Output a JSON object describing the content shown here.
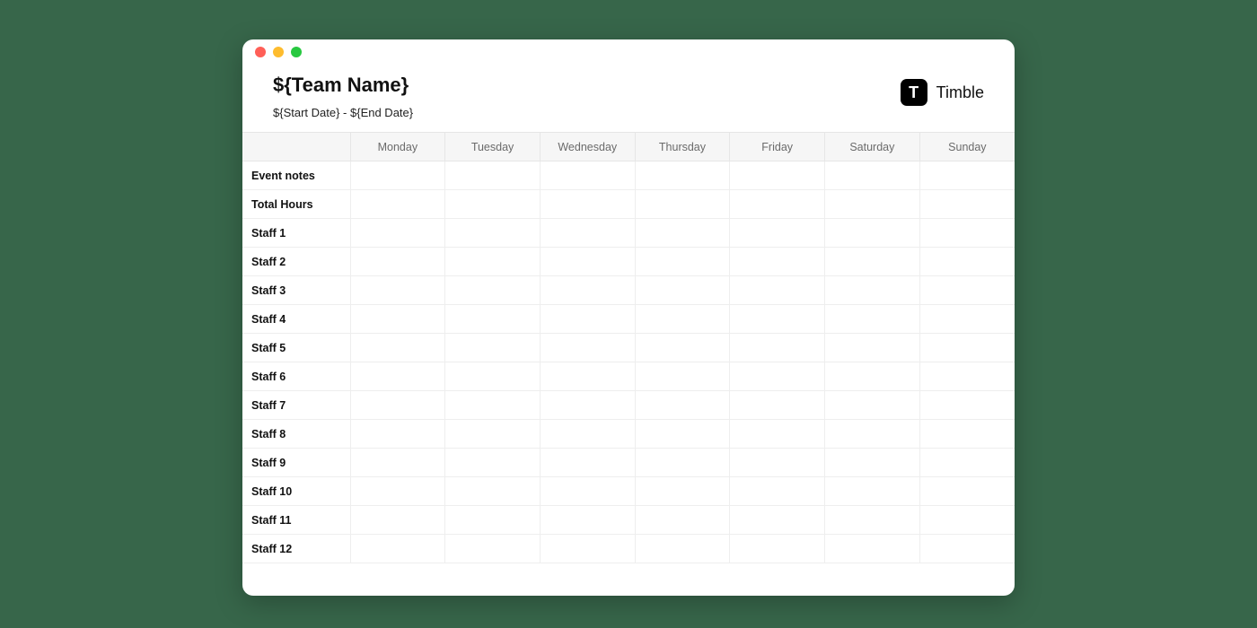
{
  "header": {
    "team_name": "${Team Name}",
    "date_range": "${Start Date} - ${End Date}"
  },
  "brand": {
    "logo_letter": "T",
    "name": "Timble"
  },
  "table": {
    "columns": [
      "Monday",
      "Tuesday",
      "Wednesday",
      "Thursday",
      "Friday",
      "Saturday",
      "Sunday"
    ],
    "rows": [
      "Event notes",
      "Total Hours",
      "Staff 1",
      "Staff 2",
      "Staff 3",
      "Staff 4",
      "Staff 5",
      "Staff 6",
      "Staff 7",
      "Staff 8",
      "Staff 9",
      "Staff 10",
      "Staff 11",
      "Staff 12"
    ]
  }
}
